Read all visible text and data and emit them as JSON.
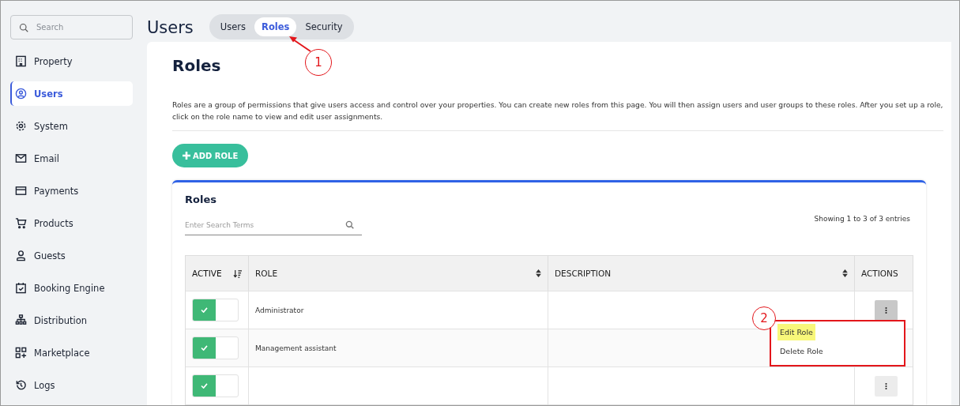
{
  "sidebar": {
    "search": {
      "placeholder": "Search"
    },
    "items": [
      {
        "label": "Property",
        "selected": false
      },
      {
        "label": "Users",
        "selected": true
      },
      {
        "label": "System",
        "selected": false
      },
      {
        "label": "Email",
        "selected": false
      },
      {
        "label": "Payments",
        "selected": false
      },
      {
        "label": "Products",
        "selected": false
      },
      {
        "label": "Guests",
        "selected": false
      },
      {
        "label": "Booking Engine",
        "selected": false
      },
      {
        "label": "Distribution",
        "selected": false
      },
      {
        "label": "Marketplace",
        "selected": false
      },
      {
        "label": "Logs",
        "selected": false
      }
    ]
  },
  "header": {
    "title": "Users",
    "tabs": [
      {
        "label": "Users",
        "selected": false
      },
      {
        "label": "Roles",
        "selected": true
      },
      {
        "label": "Security",
        "selected": false
      }
    ]
  },
  "page": {
    "title": "Roles",
    "description": "Roles are a group of permissions that give users access and control over your properties. You can create new roles from this page. You will then assign users and user groups to these roles. After you set up a role, click on the role name to view and edit user assignments.",
    "add_button": "ADD ROLE"
  },
  "card": {
    "title": "Roles",
    "search": {
      "placeholder": "Enter Search Terms"
    },
    "entries_info": "Showing 1 to 3 of 3 entries",
    "columns": [
      {
        "label": "ACTIVE",
        "sortable": true,
        "sorted": true
      },
      {
        "label": "ROLE",
        "sortable": true,
        "sorted": false
      },
      {
        "label": "DESCRIPTION",
        "sortable": true,
        "sorted": false
      },
      {
        "label": "ACTIONS",
        "sortable": false,
        "sorted": false
      }
    ],
    "rows": [
      {
        "active": true,
        "role": "Administrator",
        "menu_open": true
      },
      {
        "active": true,
        "role": "Management assistant",
        "menu_open": false
      },
      {
        "active": true,
        "menu_open": false
      }
    ],
    "action_menu": {
      "outlined": true,
      "items": [
        {
          "label": "Edit Role",
          "highlighted": true
        },
        {
          "label": "Delete Role",
          "highlighted": false
        }
      ]
    }
  },
  "callouts": [
    "1",
    "2"
  ]
}
